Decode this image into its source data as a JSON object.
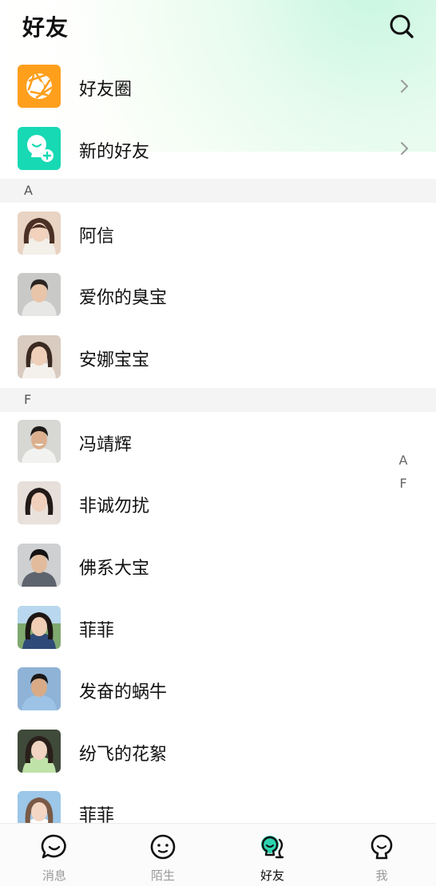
{
  "header": {
    "title": "好友"
  },
  "entries": [
    {
      "label": "好友圈",
      "icon": "camera-aperture-icon",
      "color": "#FF9F1C"
    },
    {
      "label": "新的好友",
      "icon": "add-friend-icon",
      "color": "#17D9B4"
    }
  ],
  "sections": [
    {
      "letter": "A",
      "contacts": [
        {
          "name": "阿信"
        },
        {
          "name": "爱你的臭宝"
        },
        {
          "name": "安娜宝宝"
        }
      ]
    },
    {
      "letter": "F",
      "contacts": [
        {
          "name": "冯靖辉"
        },
        {
          "name": "非诚勿扰"
        },
        {
          "name": "佛系大宝"
        },
        {
          "name": "菲菲"
        },
        {
          "name": "发奋的蜗牛"
        },
        {
          "name": "纷飞的花絮"
        },
        {
          "name": "菲菲"
        }
      ]
    }
  ],
  "index_bar": [
    "A",
    "F"
  ],
  "tabs": [
    {
      "label": "消息",
      "icon": "chat-bubble-icon",
      "active": false
    },
    {
      "label": "陌生",
      "icon": "stranger-face-icon",
      "active": false
    },
    {
      "label": "好友",
      "icon": "friends-icon",
      "active": true
    },
    {
      "label": "我",
      "icon": "profile-icon",
      "active": false
    }
  ],
  "colors": {
    "accent": "#2ED3B0",
    "orange": "#FF9F1C",
    "section_bg": "#F4F4F4"
  }
}
